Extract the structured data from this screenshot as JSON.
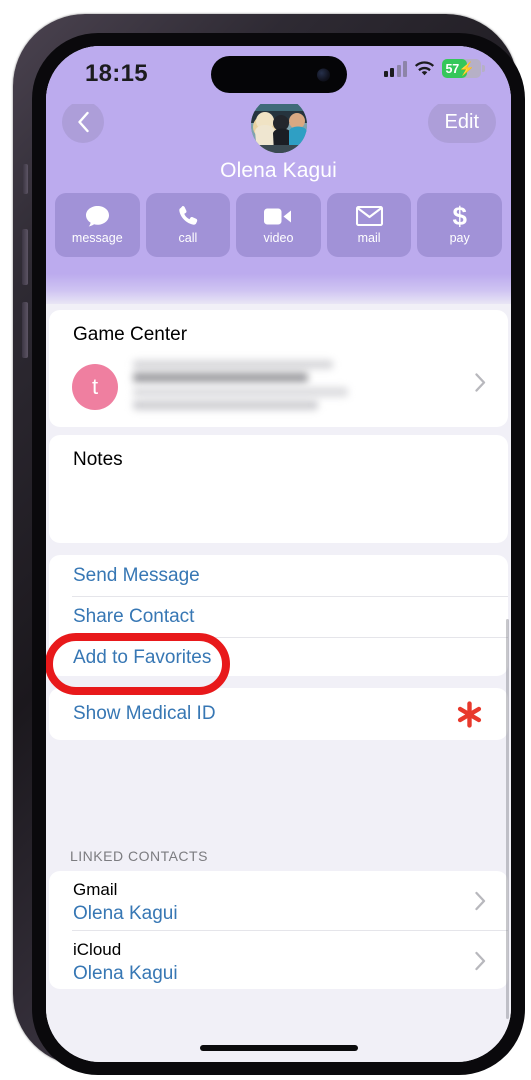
{
  "status_bar": {
    "time": "18:15",
    "battery_percent": "57",
    "battery_charging_icon": "bolt-icon",
    "wifi_icon": "wifi-icon",
    "cellular_icon": "cellular-signal-icon",
    "battery_color": "#34c759"
  },
  "header": {
    "back_label": "‹",
    "back_icon": "chevron-left-icon",
    "edit_label": "Edit",
    "contact_name": "Olena Kagui",
    "avatar_icon": "contact-photo",
    "background_color": "#bcabee"
  },
  "actions": [
    {
      "label": "message",
      "icon": "message-bubble-icon"
    },
    {
      "label": "call",
      "icon": "phone-icon"
    },
    {
      "label": "video",
      "icon": "video-camera-icon"
    },
    {
      "label": "mail",
      "icon": "envelope-icon"
    },
    {
      "label": "pay",
      "icon": "dollar-sign-icon",
      "glyph": "$"
    }
  ],
  "game_center": {
    "title": "Game Center",
    "avatar_initial": "t",
    "avatar_color": "#ef7fa0",
    "nickname_redacted": true,
    "chevron_icon": "chevron-right-icon"
  },
  "notes": {
    "title": "Notes",
    "value": ""
  },
  "link_actions": [
    {
      "label": "Send Message"
    },
    {
      "label": "Share Contact",
      "highlighted": true
    },
    {
      "label": "Add to Favorites"
    }
  ],
  "medical": {
    "label": "Show Medical ID",
    "icon": "medical-asterisk-icon",
    "icon_color": "#e8392c"
  },
  "linked": {
    "section_header": "LINKED CONTACTS",
    "rows": [
      {
        "type": "Gmail",
        "name": "Olena Kagui",
        "chevron_icon": "chevron-right-icon"
      },
      {
        "type": "iCloud",
        "name": "Olena Kagui",
        "chevron_icon": "chevron-right-icon"
      }
    ]
  },
  "annotation": {
    "shape": "oval-highlight",
    "color": "#e8191b",
    "target": "Share Contact"
  },
  "colors": {
    "link_blue": "#3777b4",
    "background": "#f1f0f7",
    "card": "#ffffff"
  }
}
